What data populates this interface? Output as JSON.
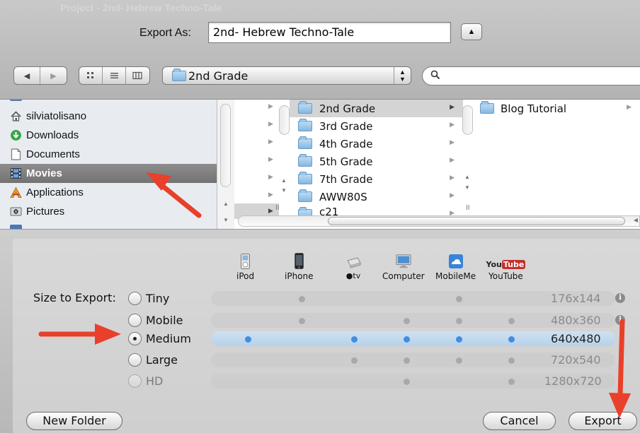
{
  "window": {
    "ghost_title": "Project - 2nd- Hebrew Techno-Tale"
  },
  "export": {
    "label": "Export As:",
    "filename": "2nd- Hebrew Techno-Tale"
  },
  "toolbar": {
    "nav_back_icon": "triangle-left-icon",
    "nav_forward_icon": "triangle-right-icon",
    "view_icons": [
      "icon-view-icon",
      "list-view-icon",
      "column-view-icon"
    ],
    "location": "2nd Grade"
  },
  "sidebar": {
    "items": [
      {
        "label": "silviatolisano",
        "icon": "home-icon"
      },
      {
        "label": "Downloads",
        "icon": "downloads-icon"
      },
      {
        "label": "Documents",
        "icon": "documents-icon"
      },
      {
        "label": "Movies",
        "icon": "movies-icon",
        "selected": true
      },
      {
        "label": "Applications",
        "icon": "applications-icon"
      },
      {
        "label": "Pictures",
        "icon": "pictures-icon"
      }
    ]
  },
  "columns": {
    "col2": [
      "2nd Grade",
      "3rd Grade",
      "4th Grade",
      "5th Grade",
      "7th Grade",
      "AWW80S",
      "c21"
    ],
    "col2_selected": "2nd Grade",
    "col3": [
      "Blog Tutorial"
    ]
  },
  "devices": [
    {
      "label": "iPod",
      "icon": "ipod-icon"
    },
    {
      "label": "iPhone",
      "icon": "iphone-icon"
    },
    {
      "label": "tv",
      "icon": "apple-tv-icon"
    },
    {
      "label": "Computer",
      "icon": "computer-icon"
    },
    {
      "label": "MobileMe",
      "icon": "mobileme-icon"
    },
    {
      "label": "YouTube",
      "icon": "youtube-icon",
      "badge": "You Tube"
    }
  ],
  "size": {
    "label": "Size to Export:",
    "options": [
      {
        "name": "Tiny",
        "res": "176x144",
        "checked": false
      },
      {
        "name": "Mobile",
        "res": "480x360",
        "checked": false
      },
      {
        "name": "Medium",
        "res": "640x480",
        "checked": true
      },
      {
        "name": "Large",
        "res": "720x540",
        "checked": false
      },
      {
        "name": "HD",
        "res": "1280x720",
        "checked": false,
        "disabled": true
      }
    ]
  },
  "buttons": {
    "new_folder": "New Folder",
    "cancel": "Cancel",
    "export": "Export"
  },
  "colors": {
    "selection_blue": "#3f8fe0",
    "annotation_arrow": "#e8402a"
  }
}
